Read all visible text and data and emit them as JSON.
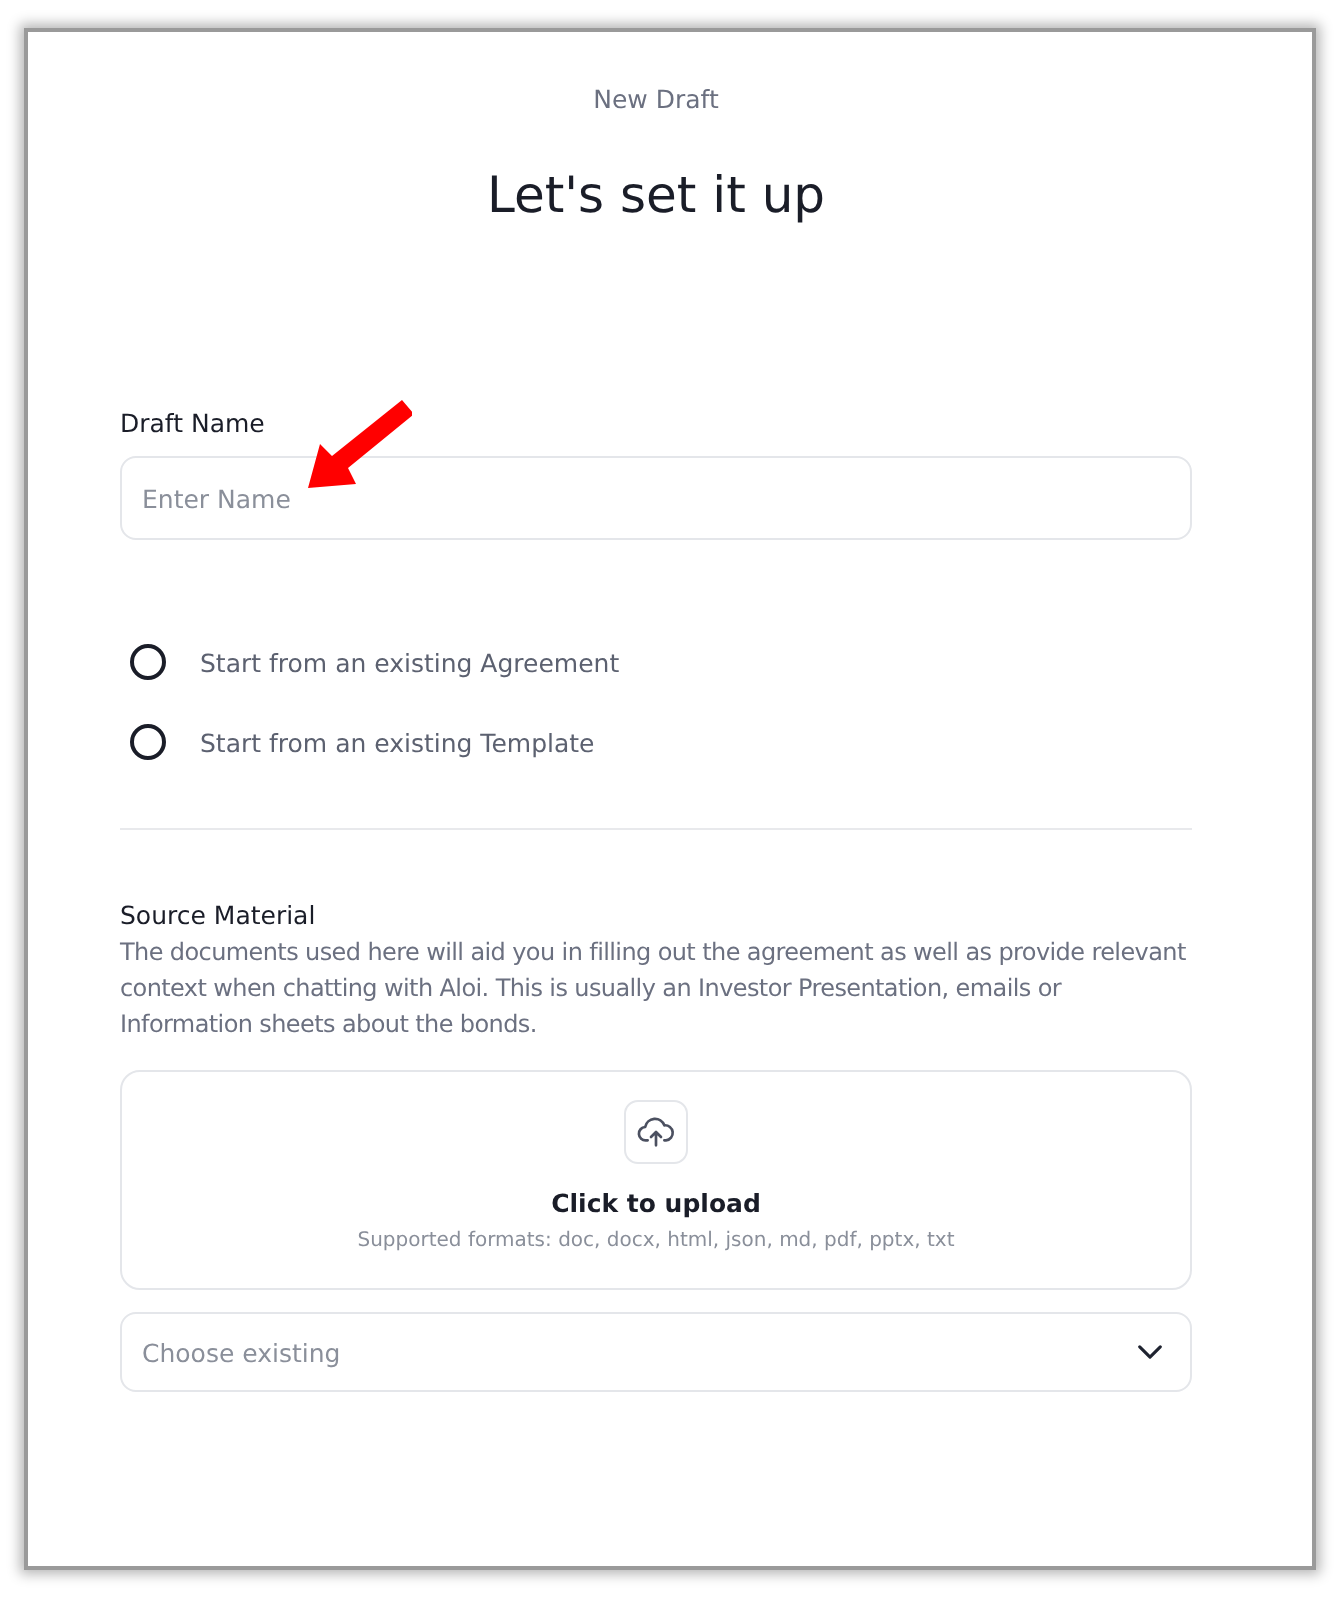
{
  "header": {
    "eyebrow": "New Draft",
    "title": "Let's set it up"
  },
  "draft_name": {
    "label": "Draft Name",
    "placeholder": "Enter Name"
  },
  "start_options": [
    {
      "label": "Start from an existing Agreement",
      "selected": false
    },
    {
      "label": "Start from an existing Template",
      "selected": false
    }
  ],
  "source_material": {
    "title": "Source Material",
    "description": "The documents used here will aid you in filling out the agreement as well as provide relevant context when chatting with Aloi. This is usually an Investor Presentation, emails or Information sheets about the bonds.",
    "upload": {
      "title": "Click to upload",
      "formats": "Supported formats: doc, docx, html, json, md, pdf, pptx, txt"
    },
    "select": {
      "placeholder": "Choose existing"
    }
  }
}
